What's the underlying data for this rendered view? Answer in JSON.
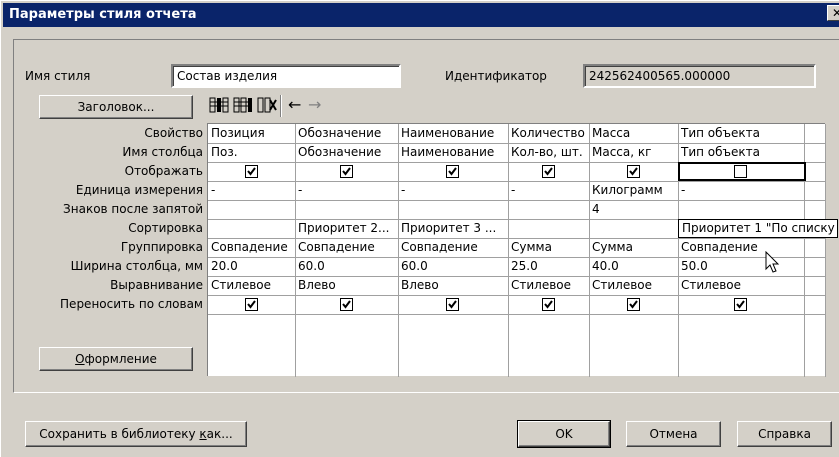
{
  "window": {
    "title": "Параметры стиля отчета",
    "close": "✕"
  },
  "style_name": {
    "label": "Имя стиля",
    "value": "Состав изделия"
  },
  "identifier": {
    "label": "Идентификатор",
    "value": "242562400565.000000"
  },
  "header_button": "Заголовок...",
  "toolbar": {
    "back": "←",
    "forward": "→"
  },
  "property_labels": [
    "Свойство",
    "Имя столбца",
    "Отображать",
    "Единица измерения",
    "Знаков после запятой",
    "Сортировка",
    "Группировка",
    "Ширина столбца, мм",
    "Выравнивание",
    "Переносить по словам"
  ],
  "design_button": {
    "underlined": "О",
    "rest": "формление"
  },
  "columns": [
    {
      "property": "Позиция",
      "column_name": "Поз.",
      "display": true,
      "unit": "-",
      "decimals": "",
      "sort": "",
      "group": "Совпадение",
      "width": "20.0",
      "align": "Стилевое",
      "wrap": true
    },
    {
      "property": "Обозначение",
      "column_name": "Обозначение",
      "display": true,
      "unit": "-",
      "decimals": "",
      "sort": "Приоритет 2...",
      "group": "Совпадение",
      "width": "60.0",
      "align": "Влево",
      "wrap": true
    },
    {
      "property": "Наименование",
      "column_name": "Наименование",
      "display": true,
      "unit": "-",
      "decimals": "",
      "sort": "Приоритет 3 ...",
      "group": "Совпадение",
      "width": "60.0",
      "align": "Влево",
      "wrap": true
    },
    {
      "property": "Количество",
      "column_name": "Кол-во, шт.",
      "display": true,
      "unit": "-",
      "decimals": "",
      "sort": "",
      "group": "Сумма",
      "width": "25.0",
      "align": "Стилевое",
      "wrap": true
    },
    {
      "property": "Масса",
      "column_name": "Масса, кг",
      "display": true,
      "unit": "Килограмм",
      "decimals": "4",
      "sort": "",
      "group": "Сумма",
      "width": "40.0",
      "align": "Стилевое",
      "wrap": true
    },
    {
      "property": "Тип объекта",
      "column_name": "Тип объекта",
      "display": false,
      "unit": "-",
      "decimals": "",
      "sort": "Приоритет 1 \"По списку",
      "group": "Совпадение",
      "width": "50.0",
      "align": "Стилевое",
      "wrap": true
    }
  ],
  "footer": {
    "save": {
      "before": "Сохранить в библиотеку ",
      "underlined": "к",
      "after": "ак..."
    },
    "ok": "OK",
    "cancel": "Отмена",
    "help": "Справка"
  }
}
